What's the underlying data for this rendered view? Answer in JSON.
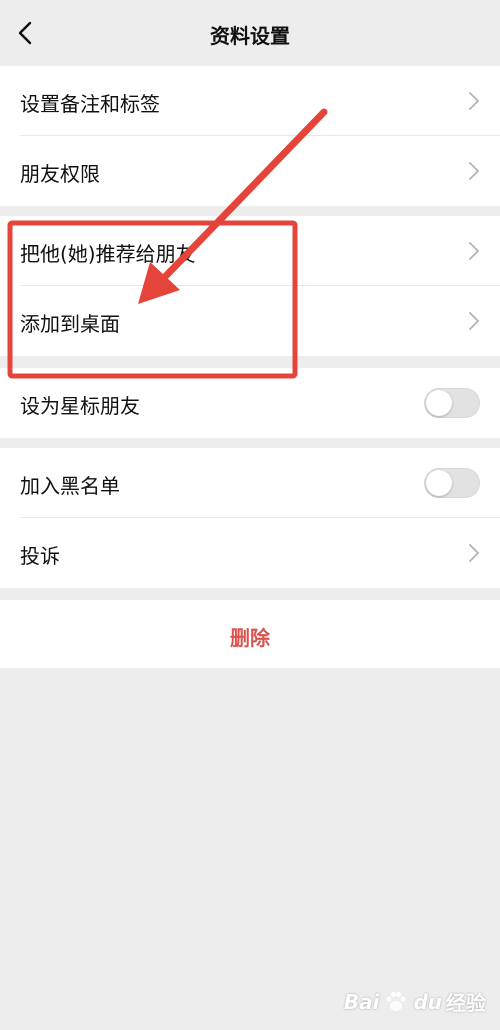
{
  "header": {
    "title": "资料设置",
    "back_icon": "chevron-left-icon"
  },
  "groups": [
    {
      "items": [
        {
          "label": "设置备注和标签",
          "control": "chevron"
        },
        {
          "label": "朋友权限",
          "control": "chevron"
        }
      ]
    },
    {
      "items": [
        {
          "label": "把他(她)推荐给朋友",
          "control": "chevron"
        },
        {
          "label": "添加到桌面",
          "control": "chevron"
        }
      ]
    },
    {
      "items": [
        {
          "label": "设为星标朋友",
          "control": "toggle",
          "on": false
        }
      ]
    },
    {
      "items": [
        {
          "label": "加入黑名单",
          "control": "toggle",
          "on": false
        },
        {
          "label": "投诉",
          "control": "chevron"
        }
      ]
    }
  ],
  "delete_label": "删除",
  "colors": {
    "background": "#ededed",
    "delete_text": "#d9534f",
    "annotation": "#e5443b"
  },
  "watermark": {
    "text_bai": "Bai",
    "text_du": "du",
    "text_jingyan": "经验"
  }
}
